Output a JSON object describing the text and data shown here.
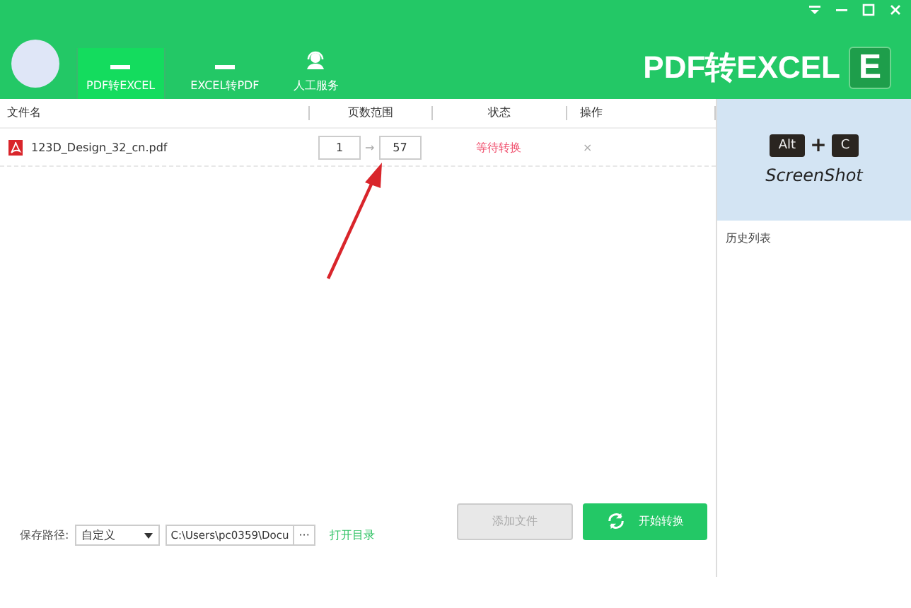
{
  "nav": {
    "tabs": [
      {
        "label": "PDF转EXCEL",
        "selected": true
      },
      {
        "label": "EXCEL转PDF",
        "selected": false
      },
      {
        "label": "人工服务",
        "selected": false
      }
    ]
  },
  "brand": {
    "title": "PDF转EXCEL",
    "logo_letter": "E"
  },
  "table": {
    "columns": [
      "文件名",
      "页数范围",
      "状态",
      "操作"
    ],
    "rows": [
      {
        "file": "123D_Design_32_cn.pdf",
        "page_from": "1",
        "arrow": "→",
        "page_to": "57",
        "status": "等待转换",
        "action": "×"
      }
    ]
  },
  "side": {
    "screenshot": {
      "key1": "Alt",
      "plus": "+",
      "key2": "C",
      "caption": "ScreenShot"
    },
    "history_label": "历史列表"
  },
  "bottom": {
    "save_label": "保存路径:",
    "mode": "自定义",
    "path": "C:\\Users\\pc0359\\Docu",
    "browse": "···",
    "open_dir": "打开目录",
    "add_button": {
      "label": "添加文件",
      "disabled": true
    },
    "start_button": {
      "label": "开始转换",
      "disabled": false
    }
  }
}
